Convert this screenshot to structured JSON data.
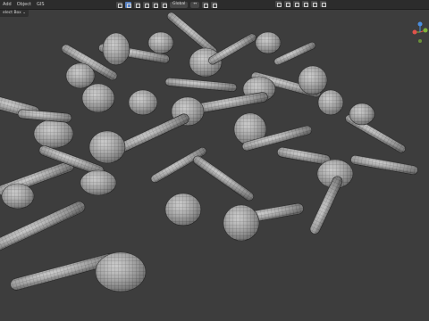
{
  "menu": [
    "Add",
    "Object",
    "GIS"
  ],
  "select_box": "elect Box ⌄",
  "transform_orientation": "Global",
  "pivot_label": "↔",
  "colors": {
    "bg": "#3d3d3d",
    "header": "#2c2c2c",
    "accent": "#5680c2",
    "x_axis": "#e0534b",
    "y_axis": "#7fb33b",
    "z_axis": "#4a8fe0"
  },
  "icons": [
    "cursor-icon",
    "select-box-icon",
    "transform-icon",
    "snap-icon",
    "gizmo-icon",
    "filter-icon"
  ]
}
